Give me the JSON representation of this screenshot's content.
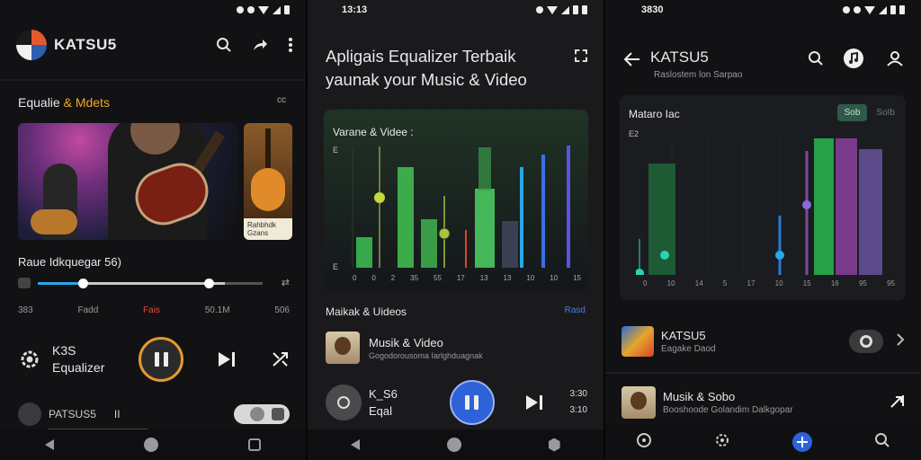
{
  "panel1": {
    "status_time": "",
    "app_title": "KATSU5",
    "section": {
      "title_main": "Equalie",
      "title_accent": "& Mdets",
      "title_icons": "ᴄᴄ"
    },
    "thumb_caption": "Rahbhdk Gzans",
    "track_title": "Raue Idkquegar 56)",
    "times": [
      "383",
      "Fadd",
      "Fais",
      "50.1M",
      "506"
    ],
    "control_label_line1": "K3S",
    "control_label_line2": "Equalizer",
    "mini_player_name": "PATSUS5",
    "mini_player_suffix": "II",
    "slider_value": 0.76,
    "colors": {
      "accent": "#f5a623",
      "slider": "#2aa7e6",
      "highlight": "#e2483a"
    }
  },
  "panel2": {
    "status_time": "13:13",
    "headline": "Apligais Equalizer Terbaik yaunak your Music & Video",
    "eq_label": "Varane & Videe :",
    "eq_axis_top": "E",
    "eq_axis_bottom": "E",
    "eq_ticks": [
      "0",
      "0",
      "2",
      "35",
      "55",
      "17",
      "13",
      "13",
      "10",
      "10",
      "15"
    ],
    "list_title": "Maikak & Uideos",
    "list_action": "Rasd",
    "row_title": "Musik & Video",
    "row_sub": "Gogodorousoma Iarlghduagnak",
    "control_label_line1": "K_S6",
    "control_label_line2": "Eqal",
    "side_time_top": "3:30",
    "side_time_bottom": "3:10",
    "colors": {
      "play": "#2e62d9",
      "action": "#4b7be8"
    }
  },
  "panel3": {
    "status_time": "3830",
    "title": "KATSU5",
    "subtitle": "Raslostem lon Sarpao",
    "eq_label": "Mataro Iac",
    "eq_axis_top": "E2",
    "seg_on": "Sob",
    "seg_off": "SoIb",
    "eq_ticks": [
      "0",
      "10",
      "14",
      "5",
      "17",
      "10",
      "15",
      "16",
      "95",
      "95"
    ],
    "row1_title": "KATSU5",
    "row1_sub": "Eagake Daod",
    "row2_title": "Musik & Sobo",
    "row2_sub": "Booshoode Golandim Dalkgopar"
  }
}
